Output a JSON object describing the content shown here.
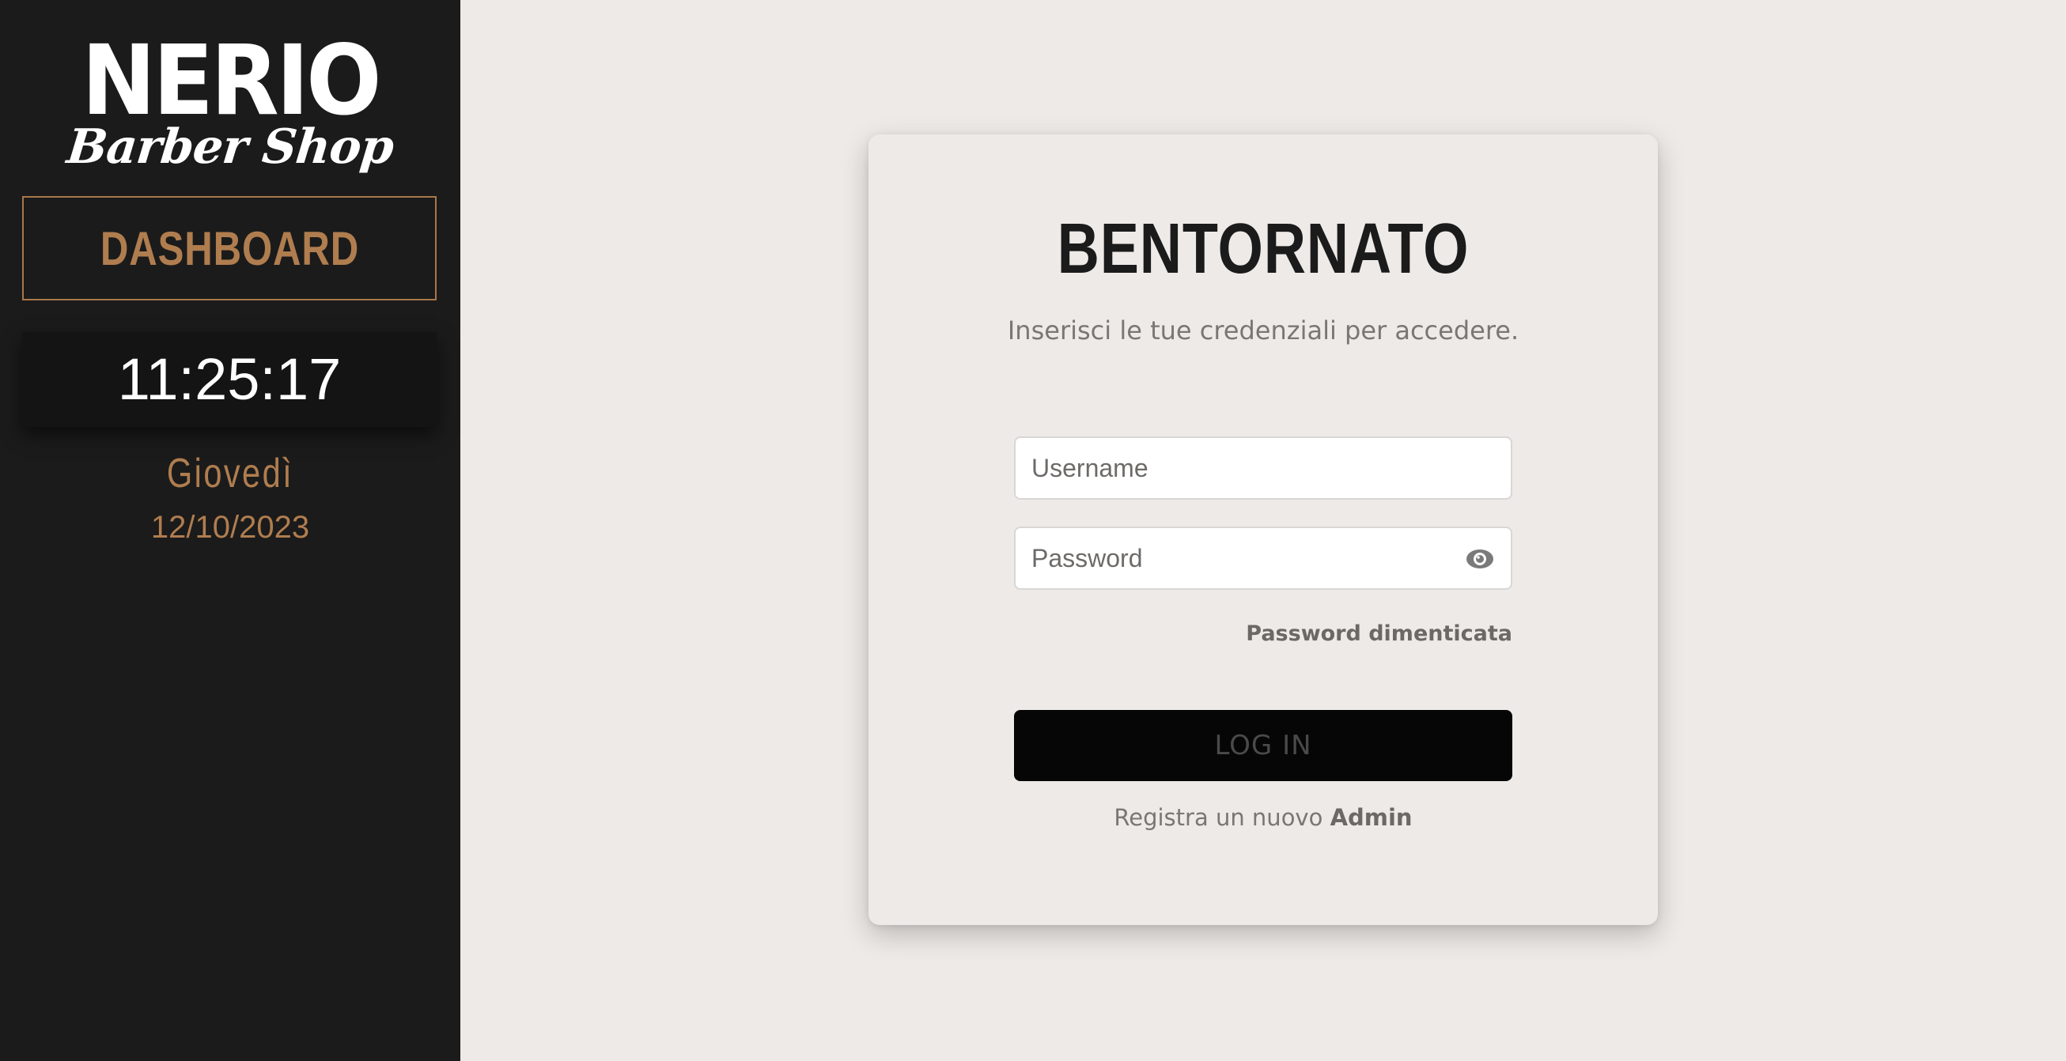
{
  "sidebar": {
    "logo": {
      "main": "NERIO",
      "sub": "Barber Shop"
    },
    "dashboard_label": "DASHBOARD",
    "clock": {
      "time": "11:25:17",
      "day": "Giovedì",
      "date": "12/10/2023"
    }
  },
  "login": {
    "title": "BENTORNATO",
    "subtitle": "Inserisci le tue credenziali per accedere.",
    "username": {
      "value": "",
      "placeholder": "Username"
    },
    "password": {
      "value": "",
      "placeholder": "Password",
      "toggle_icon": "eye-icon"
    },
    "forgot_password": "Password dimenticata",
    "submit_label": "LOG IN",
    "register_prefix": "Registra un nuovo",
    "register_link": "Admin"
  },
  "colors": {
    "sidebar_bg": "#1b1b1b",
    "accent": "#b07d4f",
    "page_bg": "#eeeae7",
    "button_bg": "#060606"
  }
}
